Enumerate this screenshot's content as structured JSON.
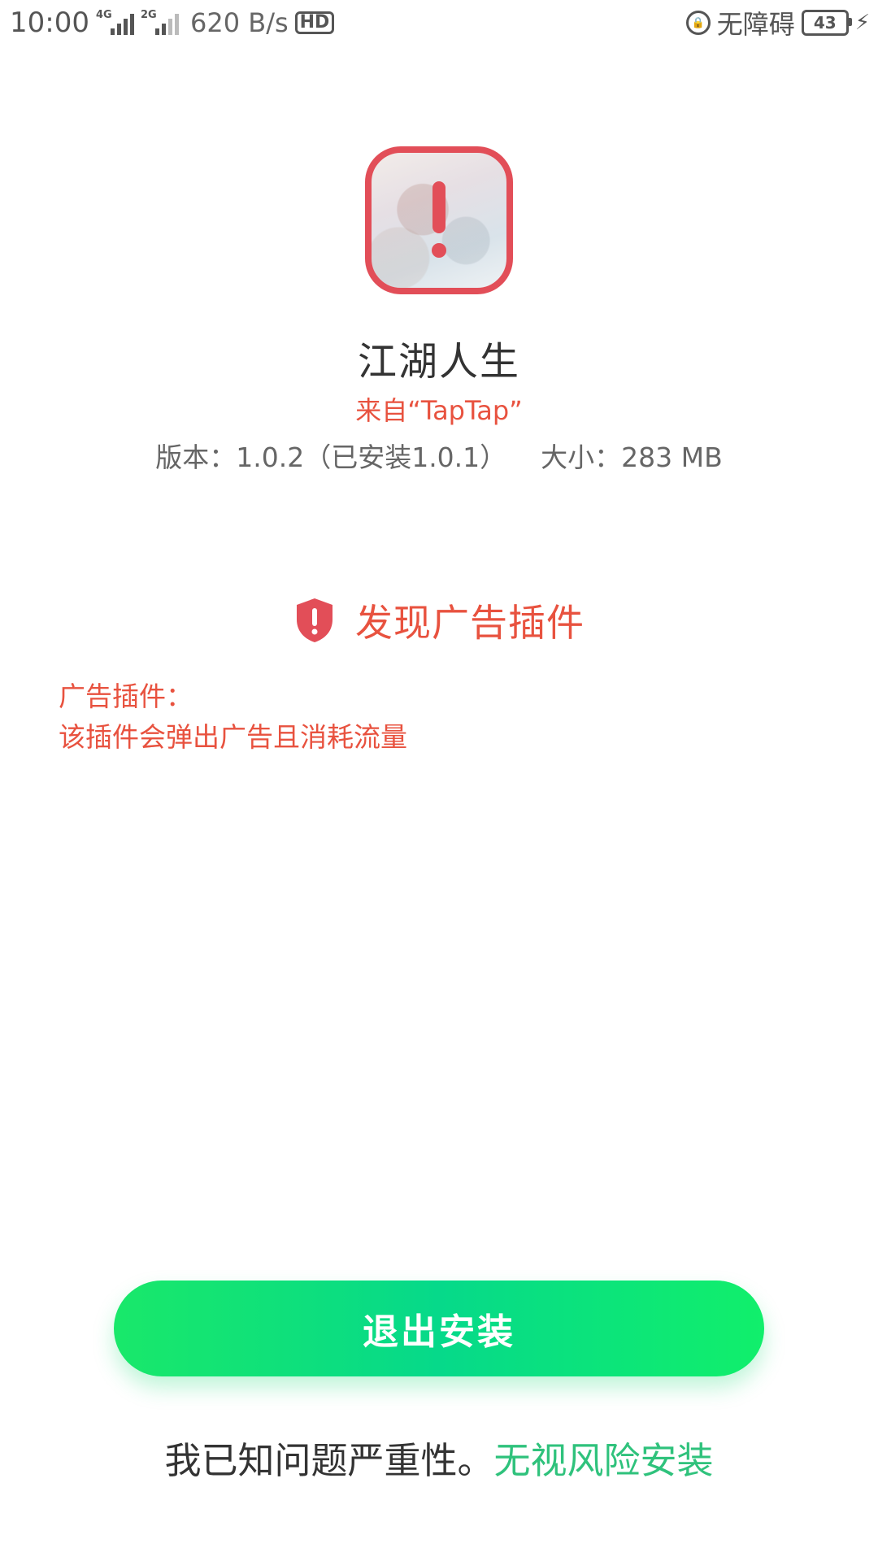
{
  "status_bar": {
    "time": "10:00",
    "signal1_label": "4G",
    "signal2_label": "2G",
    "net_speed": "620 B/s",
    "hd_label": "HD",
    "accessibility": "无障碍",
    "battery": "43",
    "icons": [
      "signal-4g-icon",
      "signal-2g-icon",
      "hd-call-icon",
      "rotation-lock-icon",
      "battery-icon",
      "charging-icon"
    ]
  },
  "app": {
    "icon": "app-warning-icon",
    "name": "江湖人生",
    "source": "来自“TapTap”",
    "version": "版本：1.0.2（已安装1.0.1）",
    "size": "大小：283 MB"
  },
  "warning": {
    "icon": "shield-alert-icon",
    "title": "发现广告插件",
    "plugin_label": "广告插件：",
    "plugin_description": "该插件会弹出广告且消耗流量"
  },
  "actions": {
    "exit_label": "退出安装",
    "ignore_prefix": "我已知问题严重性。",
    "ignore_link": "无视风险安装"
  },
  "colors": {
    "accent_red": "#e8523f",
    "icon_border_red": "#e24e58",
    "button_green": "#06d98a",
    "link_green": "#2fc27c"
  }
}
